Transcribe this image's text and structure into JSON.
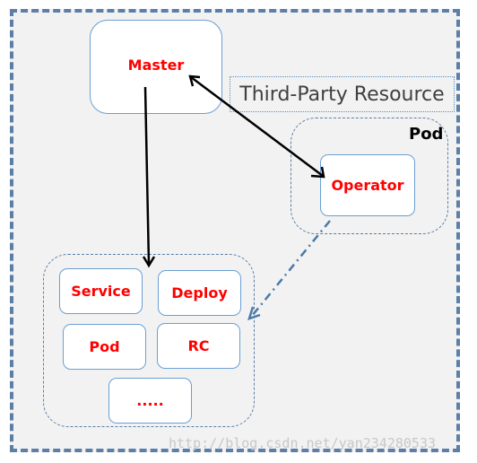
{
  "nodes": {
    "master": "Master",
    "operator": "Operator",
    "service": "Service",
    "deploy": "Deploy",
    "pod": "Pod",
    "rc": "RC",
    "more": "....."
  },
  "labels": {
    "third_party_resource": "Third-Party Resource",
    "pod_group": "Pod"
  },
  "watermark": "http://blog.csdn.net/yan234280533",
  "colors": {
    "node_text": "#ff0000",
    "node_border": "#6a9fd4",
    "group_border": "#5b7fa6",
    "background": "#f2f2f2"
  }
}
